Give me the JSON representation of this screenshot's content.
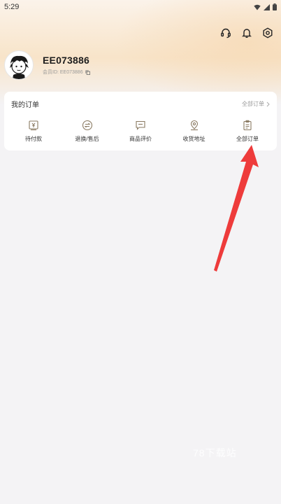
{
  "status_bar": {
    "time": "5:29"
  },
  "profile": {
    "username": "EE073886",
    "member_line": "会员ID: EE073886"
  },
  "orders": {
    "title": "我的订单",
    "view_all": "全部订单",
    "items": [
      {
        "label": "待付款",
        "icon": "payment-icon"
      },
      {
        "label": "退换/售后",
        "icon": "refund-icon"
      },
      {
        "label": "商品评价",
        "icon": "review-icon"
      },
      {
        "label": "收货地址",
        "icon": "location-icon"
      },
      {
        "label": "全部订单",
        "icon": "order-list-icon"
      }
    ]
  },
  "watermark": "78下载站",
  "colors": {
    "accent_arrow": "#ee3b3b",
    "header_gold": "#f8e4c9",
    "icon_brown": "#8a7a62"
  }
}
